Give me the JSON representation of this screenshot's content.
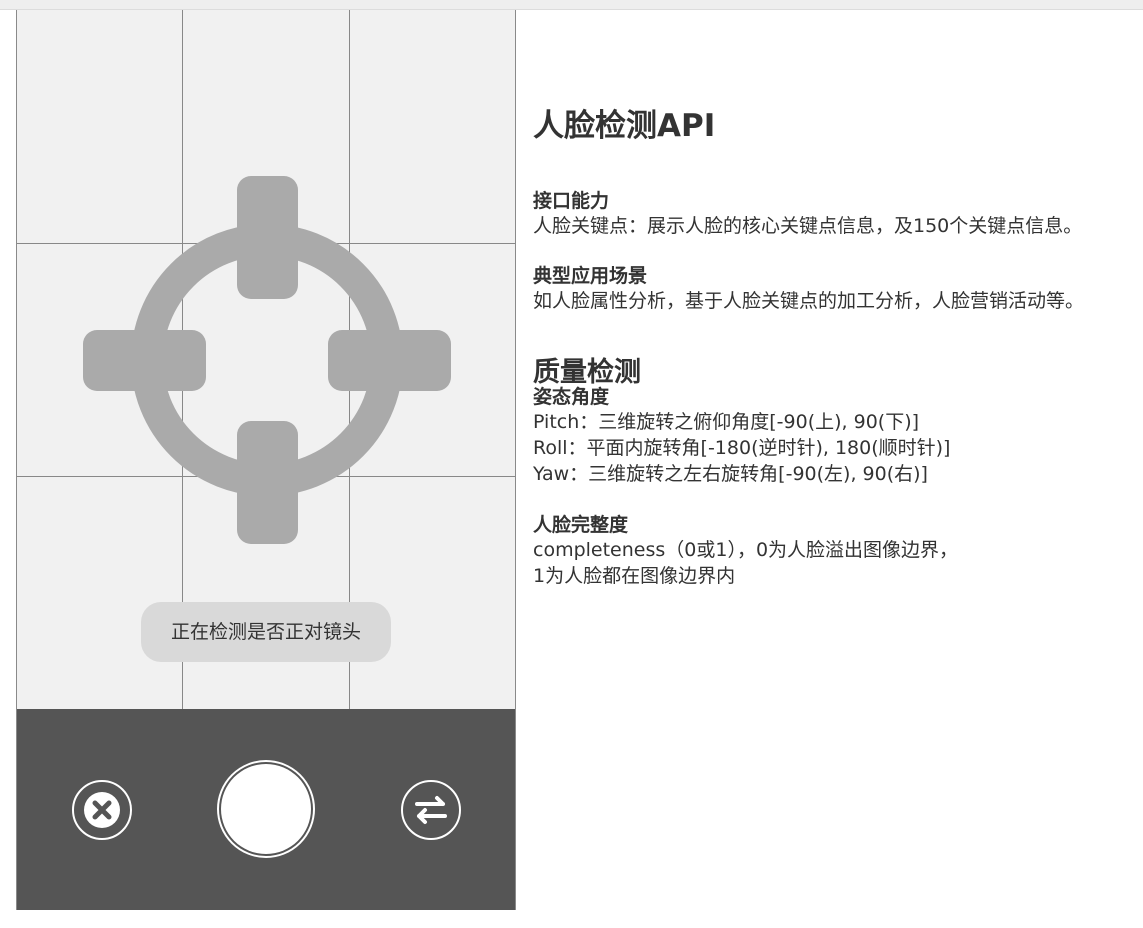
{
  "camera": {
    "status_message": "正在检测是否正对镜头"
  },
  "controls": {
    "close_icon": "close-icon",
    "shutter_icon": "shutter-icon",
    "switch_camera_icon": "switch-camera-icon"
  },
  "colors": {
    "viewfinder_bg": "#f1f1f1",
    "target_gray": "#aaaaaa",
    "control_bar": "#555555",
    "toast_bg": "#d9d9d9"
  },
  "info": {
    "title": "人脸检测API",
    "capability": {
      "heading": "接口能力",
      "text": "人脸关键点：展示人脸的核心关键点信息，及150个关键点信息。"
    },
    "scenario": {
      "heading": "典型应用场景",
      "text": "如人脸属性分析，基于人脸关键点的加工分析，人脸营销活动等。"
    },
    "quality": {
      "title": "质量检测",
      "pose": {
        "heading": "姿态角度",
        "lines": [
          "Pitch：三维旋转之俯仰角度[-90(上), 90(下)]",
          "Roll：平面内旋转角[-180(逆时针), 180(顺时针)]",
          "Yaw：三维旋转之左右旋转角[-90(左), 90(右)]"
        ]
      },
      "completeness": {
        "heading": "人脸完整度",
        "lines": [
          "completeness（0或1），0为人脸溢出图像边界，",
          "1为人脸都在图像边界内"
        ]
      }
    }
  }
}
